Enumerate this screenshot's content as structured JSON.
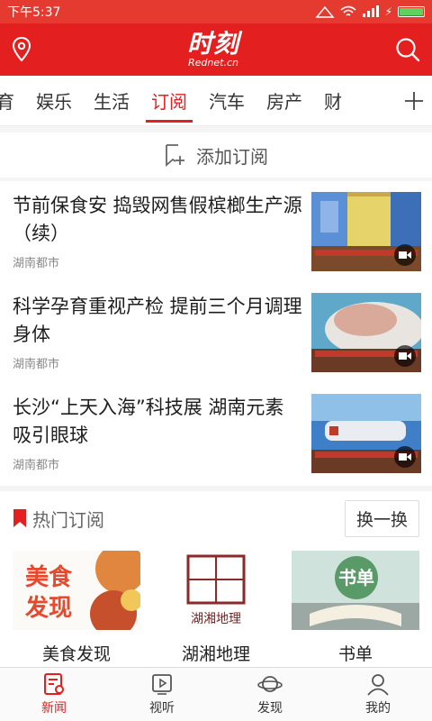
{
  "status": {
    "time": "下午5:37"
  },
  "header": {
    "logo_main": "时刻",
    "logo_sub": "Rednet.cn"
  },
  "tabs": [
    {
      "label": "育",
      "partial": true
    },
    {
      "label": "娱乐"
    },
    {
      "label": "生活"
    },
    {
      "label": "订阅",
      "active": true
    },
    {
      "label": "汽车"
    },
    {
      "label": "房产"
    },
    {
      "label": "财"
    }
  ],
  "add_subscription": {
    "label": "添加订阅"
  },
  "news": [
    {
      "title": "节前保食安 捣毁网售假槟榔生产源（续）",
      "source": "湖南都市"
    },
    {
      "title": "科学孕育重视产检 提前三个月调理身体",
      "source": "湖南都市"
    },
    {
      "title": "长沙“上天入海”科技展 湖南元素吸引眼球",
      "source": "湖南都市"
    }
  ],
  "hot": {
    "title": "热门订阅",
    "swap_label": "换一换",
    "cards": [
      {
        "name": "美食发现",
        "img_text_1": "美食",
        "img_text_2": "发现"
      },
      {
        "name": "湖湘地理",
        "img_text_1": "湖湘地理"
      },
      {
        "name": "书单",
        "img_text_1": "书单"
      }
    ]
  },
  "bottom_nav": [
    {
      "label": "新闻",
      "active": true
    },
    {
      "label": "视听"
    },
    {
      "label": "发现"
    },
    {
      "label": "我的"
    }
  ],
  "colors": {
    "brand": "#e31f1f"
  }
}
